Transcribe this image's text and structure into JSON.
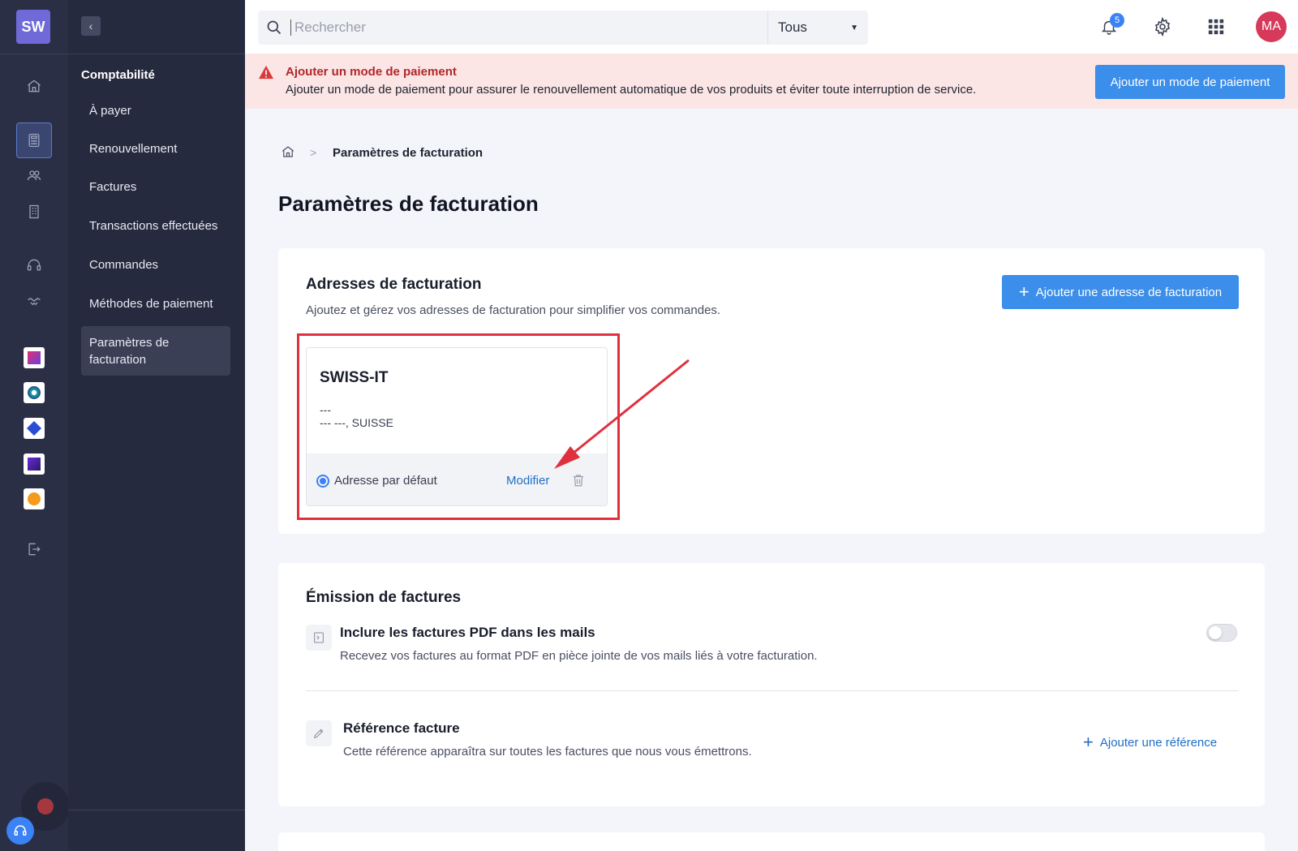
{
  "logo": {
    "text": "SW"
  },
  "colors": {
    "accent": "#3b8eea",
    "sidebar": "#2b2f45",
    "alert_bg": "#fbe5e5",
    "alert_title": "#b1282b",
    "avatar": "#d6395a",
    "highlight": "#e0303d"
  },
  "rail": {
    "icons": [
      "home-icon",
      "calculator-icon",
      "users-icon",
      "building-icon",
      "headset-icon",
      "handshake-icon",
      "logout-icon"
    ],
    "apps": [
      "kanban-app-icon",
      "monitor-app-icon",
      "cube-app-icon",
      "chart-app-icon",
      "energy-app-icon"
    ]
  },
  "subnav": {
    "title": "Comptabilité",
    "items": [
      {
        "label": "À payer"
      },
      {
        "label": "Renouvellement"
      },
      {
        "label": "Factures"
      },
      {
        "label": "Transactions effectuées"
      },
      {
        "label": "Commandes"
      },
      {
        "label": "Méthodes de paiement"
      },
      {
        "label": "Paramètres de facturation",
        "active": true
      }
    ]
  },
  "topbar": {
    "search_placeholder": "Rechercher",
    "scope": "Tous",
    "notifications_count": "5",
    "avatar_initials": "MA"
  },
  "alert": {
    "title": "Ajouter un mode de paiement",
    "text": "Ajouter un mode de paiement pour assurer le renouvellement automatique de vos produits et éviter toute interruption de service.",
    "button": "Ajouter un mode de paiement"
  },
  "breadcrumb": {
    "current": "Paramètres de facturation",
    "separator": ">"
  },
  "page_title": "Paramètres de facturation",
  "addresses": {
    "title": "Adresses de facturation",
    "subtitle": "Ajoutez et gérez vos adresses de facturation pour simplifier vos commandes.",
    "add_button": "Ajouter une adresse de facturation",
    "card": {
      "name": "SWISS-IT",
      "line1": "---",
      "line2": "--- ---, SUISSE",
      "default_label": "Adresse par défaut",
      "is_default": true,
      "modify_label": "Modifier"
    }
  },
  "invoicing": {
    "title": "Émission de factures",
    "pdf": {
      "title": "Inclure les factures PDF dans les mails",
      "subtitle": "Recevez vos factures au format PDF en pièce jointe de vos mails liés à votre facturation.",
      "enabled": false
    },
    "reference": {
      "title": "Référence facture",
      "subtitle": "Cette référence apparaîtra sur toutes les factures que nous vous émettrons.",
      "add_label": "Ajouter une référence"
    }
  }
}
